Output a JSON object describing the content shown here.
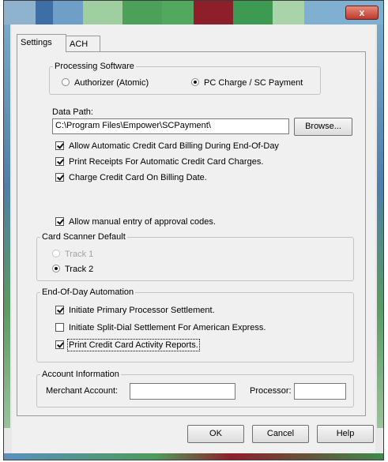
{
  "window": {
    "close_glyph": "x"
  },
  "tabs": {
    "settings": "Settings",
    "ach": "ACH"
  },
  "processing_software": {
    "legend": "Processing Software",
    "options": [
      "Authorizer (Atomic)",
      "PC Charge / SC Payment"
    ],
    "selected": "PC Charge / SC Payment"
  },
  "data_path": {
    "label": "Data Path:",
    "value": "C:\\Program Files\\Empower\\SCPayment\\",
    "browse_label": "Browse..."
  },
  "options": {
    "auto_billing": {
      "label": "Allow Automatic Credit Card Billing During End-Of-Day",
      "checked": true
    },
    "print_receipts": {
      "label": "Print Receipts For Automatic Credit Card Charges.",
      "checked": true
    },
    "charge_on_billing": {
      "label": "Charge Credit Card On Billing Date.",
      "checked": true
    },
    "manual_approval": {
      "label": "Allow manual entry of approval codes.",
      "checked": true
    }
  },
  "card_scanner": {
    "legend": "Card Scanner Default",
    "track1": "Track 1",
    "track2": "Track 2",
    "selected": "Track 2"
  },
  "eod": {
    "legend": "End-Of-Day Automation",
    "primary_settlement": {
      "label": "Initiate Primary Processor Settlement.",
      "checked": true
    },
    "split_dial": {
      "label": "Initiate Split-Dial Settlement For American Express.",
      "checked": false
    },
    "print_reports": {
      "label": "Print Credit Card Activity Reports.",
      "checked": true
    }
  },
  "account_info": {
    "legend": "Account Information",
    "merchant_label": "Merchant Account:",
    "merchant_value": "",
    "processor_label": "Processor:",
    "processor_value": ""
  },
  "buttons": {
    "ok": "OK",
    "cancel": "Cancel",
    "help": "Help"
  },
  "icons": {
    "check": "check-mark",
    "radio": "radio-dot",
    "close": "close-x"
  }
}
